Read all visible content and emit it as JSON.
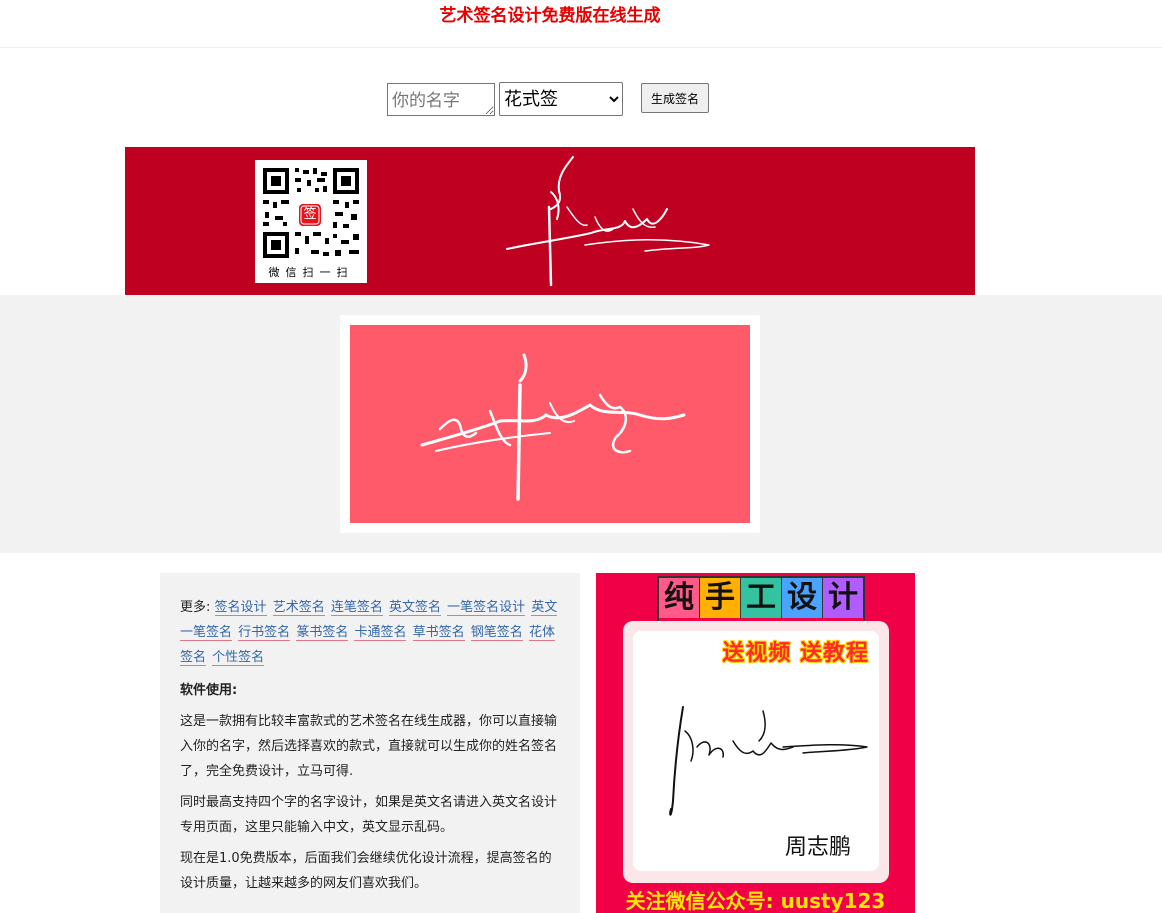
{
  "page": {
    "title": "艺术签名设计免费版在线生成"
  },
  "form": {
    "name_placeholder": "你的名字",
    "style_selected": "花式签",
    "style_options": [
      "花式签"
    ],
    "submit_label": "生成签名"
  },
  "banner": {
    "qr_caption": "微信扫一扫",
    "qr_center_glyph": "签"
  },
  "info": {
    "more_prefix": "更多:",
    "links": [
      "签名设计",
      "艺术签名",
      "连笔签名",
      "英文签名",
      "一笔签名设计",
      "英文一笔签名",
      "行书签名",
      "篆书签名",
      "卡通签名",
      "草书签名",
      "钢笔签名",
      "花体签名",
      "个性签名"
    ],
    "usage_heading": "软件使用:",
    "paragraphs": [
      "这是一款拥有比较丰富款式的艺术签名在线生成器，你可以直接输入你的名字，然后选择喜欢的款式，直接就可以生成你的姓名签名了，完全免费设计，立马可得.",
      "同时最高支持四个字的名字设计，如果是英文名请进入英文名设计专用页面，这里只能输入中文，英文显示乱码。",
      "现在是1.0免费版本，后面我们会继续优化设计流程，提高签名的设计质量，让越来越多的网友们喜欢我们。"
    ]
  },
  "ad": {
    "title_chars": [
      "纯",
      "手",
      "工",
      "设",
      "计"
    ],
    "title_colors": [
      "#ff5a8a",
      "#ffb000",
      "#33c3a0",
      "#4aa3ff",
      "#b05cff"
    ],
    "promo": "送视频 送教程",
    "sample_name": "周志鹏",
    "footer": "关注微信公众号: uusty123"
  },
  "colors": {
    "title_red": "#e60000",
    "banner_bg": "#c00021",
    "result_bg": "#fe5a6a",
    "ad_bg": "#f00046"
  }
}
